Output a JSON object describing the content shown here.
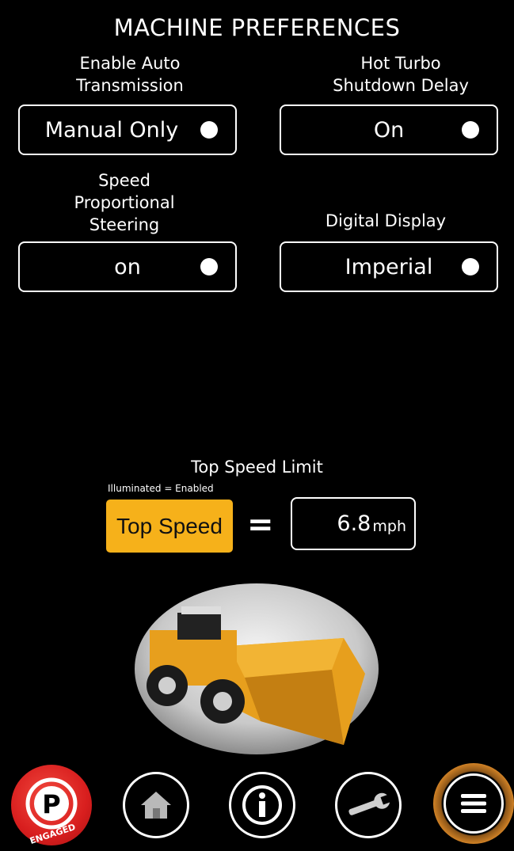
{
  "header": {
    "title": "MACHINE PREFERENCES"
  },
  "settings": [
    {
      "label_line1": "Enable Auto",
      "label_line2": "Transmission",
      "value": "Manual Only"
    },
    {
      "label_line1": "Hot Turbo",
      "label_line2": "Shutdown Delay",
      "value": "On"
    },
    {
      "label_line1": "Speed",
      "label_line2": "Proportional",
      "label_line3": "Steering",
      "value": "on"
    },
    {
      "label_line1": "Digital Display",
      "value": "Imperial"
    }
  ],
  "top_speed": {
    "title": "Top Speed Limit",
    "hint": "Illuminated = Enabled",
    "button_label": "Top Speed",
    "equals": "=",
    "value": "6.8",
    "unit": "mph",
    "button_color": "#f6b11a"
  },
  "nav": {
    "parking_letter": "P",
    "parking_status": "ENGAGED",
    "items": [
      {
        "name": "home",
        "icon": "home-icon"
      },
      {
        "name": "info",
        "icon": "info-icon"
      },
      {
        "name": "tools",
        "icon": "wrench-icon"
      },
      {
        "name": "menu",
        "icon": "menu-icon"
      }
    ],
    "accent_color": "#e6902a",
    "park_color": "#d81e1e"
  }
}
